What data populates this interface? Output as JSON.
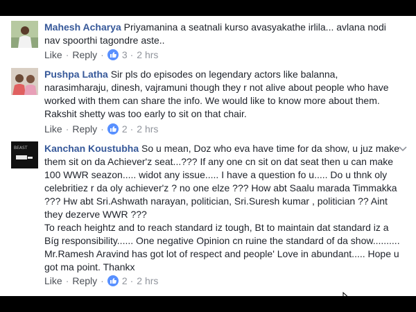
{
  "comments": [
    {
      "author": "Mahesh Acharya",
      "text": "Priyamanina a seatnali kurso avasyakathe irlila... avlana nodi nav spoorthi tagondre aste..",
      "like_label": "Like",
      "reply_label": "Reply",
      "like_count": "3",
      "time": "2 hrs",
      "avatar_icon": "person-photo"
    },
    {
      "author": "Pushpa Latha",
      "text": "Sir pls do episodes on legendary actors like balanna, narasimharaju, dinesh, vajramuni though they r not alive about people who have worked with them can share the info. We would like to know more about them. Rakshit shetty was too early to sit on that chair.",
      "like_label": "Like",
      "reply_label": "Reply",
      "like_count": "2",
      "time": "2 hrs",
      "avatar_icon": "couple-photo"
    },
    {
      "author": "Kanchan Koustubha",
      "text_lines": [
        "So u mean, Doz who eva have time for da show, u juz make them sit on da Achiever'z seat...??? If any one cn sit on dat seat then u can make 100 WWR seazon..... widot any issue..... I have a question fo u..... Do u thnk oly celebritiez r da oly achiever'z ? no one elze ??? How abt Saalu marada Timmakka ??? Hw abt Sri.Ashwath narayan, politician, Sri.Suresh kumar , politician ?? Aint they dezerve WWR ???",
        "To reach heightz and to reach standard iz tough, Bt to maintain dat standard iz a Bíg responsibility...... One negative Opinion cn ruine the standard of da show.......... Mr.Ramesh Aravind has got lot of respect and people' Love in abundant..... Hope u got ma point. Thankx"
      ],
      "like_label": "Like",
      "reply_label": "Reply",
      "like_count": "2",
      "time": "2 hrs",
      "avatar_icon": "beast-logo",
      "avatar_text": "BEAST"
    }
  ],
  "colors": {
    "author": "#365899",
    "text": "#1d2129",
    "meta": "#90949c",
    "like_badge": "#5890ff"
  }
}
